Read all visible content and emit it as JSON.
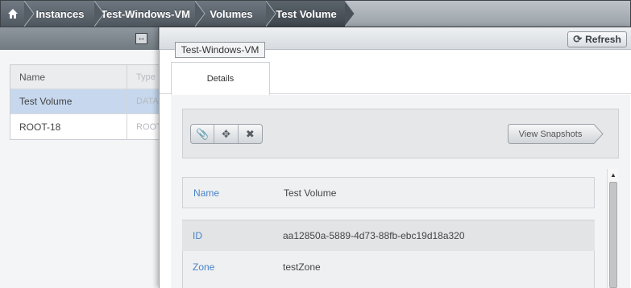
{
  "breadcrumb": {
    "home_icon": "home-icon",
    "items": [
      "Instances",
      "Test-Windows-VM",
      "Volumes",
      "Test Volume"
    ]
  },
  "list": {
    "columns": [
      "Name",
      "Type"
    ],
    "rows": [
      {
        "name": "Test Volume",
        "type": "DATA"
      },
      {
        "name": "ROOT-18",
        "type": "ROOT"
      }
    ]
  },
  "detail": {
    "refresh_label": "Refresh",
    "tooltip": "Test-Windows-VM",
    "tab_label": "Details",
    "actions": [
      "attach-icon",
      "move-icon",
      "delete-icon"
    ],
    "view_snapshots_label": "View Snapshots",
    "fields": [
      {
        "label": "Name",
        "value": "Test Volume"
      },
      {
        "label": "ID",
        "value": "aa12850a-5889-4d73-88fb-ebc19d18a320"
      },
      {
        "label": "Zone",
        "value": "testZone"
      }
    ]
  },
  "colors": {
    "link_blue": "#4a83c8",
    "selected_row": "#c7d8ee",
    "breadcrumb_dark": "#4d555d"
  }
}
